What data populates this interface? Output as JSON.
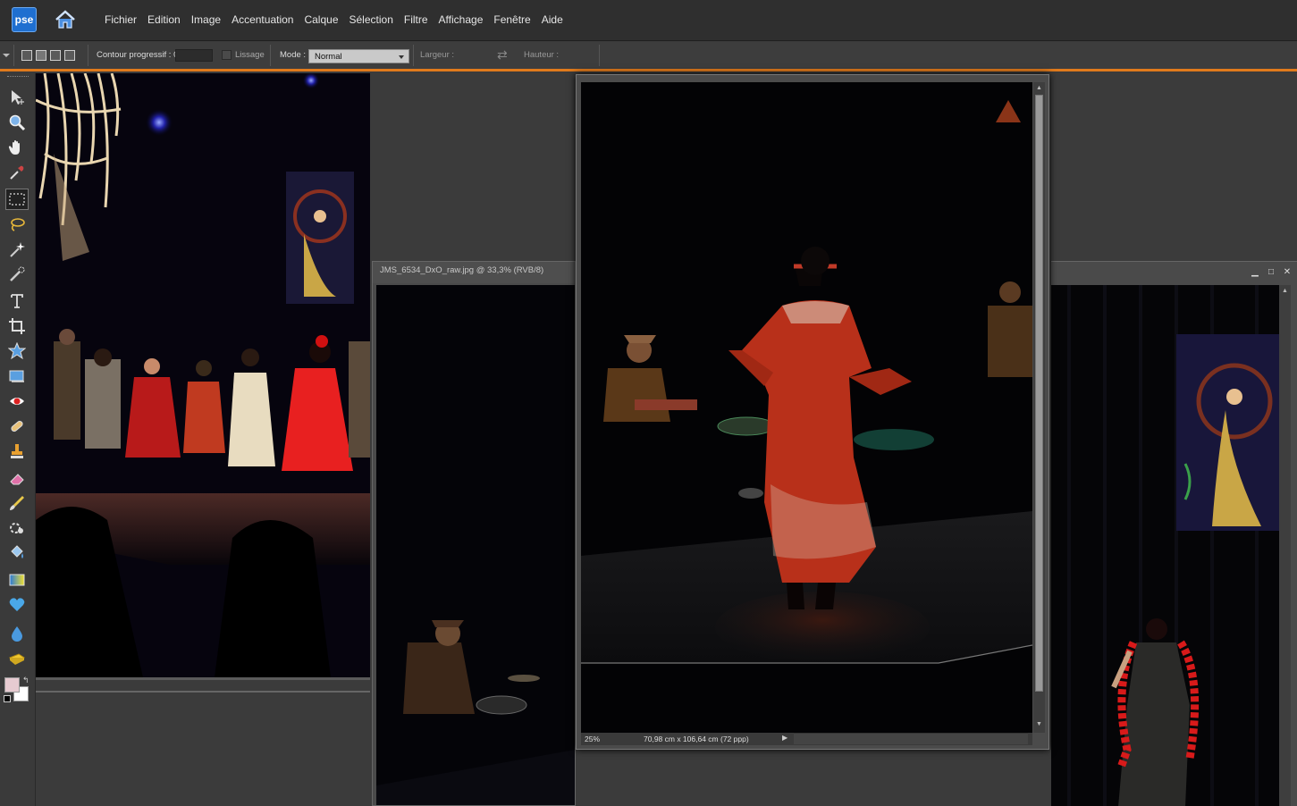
{
  "app": {
    "logo_text": "pse",
    "menu": [
      "Fichier",
      "Edition",
      "Image",
      "Accentuation",
      "Calque",
      "Sélection",
      "Filtre",
      "Affichage",
      "Fenêtre",
      "Aide"
    ]
  },
  "options_bar": {
    "feather_label": "Contour progressif : 0 px",
    "antialias_label": "Lissage",
    "mode_label": "Mode :",
    "mode_value": "Normal",
    "width_label": "Largeur :",
    "height_label": "Hauteur :"
  },
  "documents": {
    "doc2_title": "JMS_6534_DxO_raw.jpg @ 33,3% (RVB/8)",
    "active_zoom": "25%",
    "active_dimensions": "70,98 cm x 106,64 cm (72 ppp)"
  },
  "colors": {
    "accent": "#e07a1c",
    "foreground_swatch": "#e7cbd1",
    "background_swatch": "#ffffff"
  },
  "tools": [
    "move-tool-icon",
    "zoom-tool-icon",
    "hand-tool-icon",
    "eyedropper-tool-icon",
    "rectangular-marquee-tool-icon",
    "lasso-tool-icon",
    "magic-wand-tool-icon",
    "quick-selection-tool-icon",
    "type-tool-icon",
    "crop-tool-icon",
    "cookie-cutter-tool-icon",
    "straighten-tool-icon",
    "red-eye-tool-icon",
    "healing-brush-tool-icon",
    "clone-stamp-tool-icon",
    "eraser-tool-icon",
    "brush-tool-icon",
    "smart-brush-tool-icon",
    "paint-bucket-tool-icon",
    "gradient-tool-icon",
    "shape-tool-icon",
    "blur-tool-icon",
    "sponge-tool-icon"
  ]
}
